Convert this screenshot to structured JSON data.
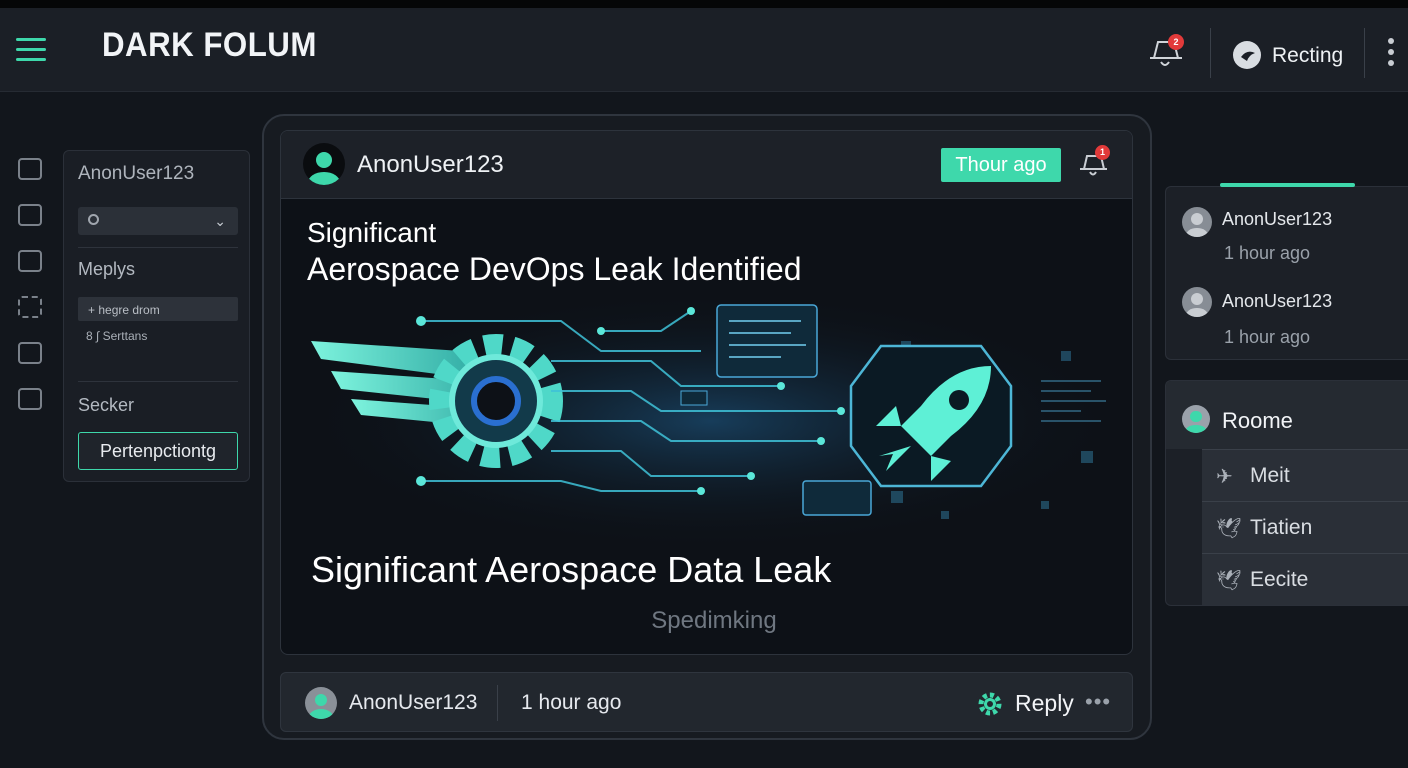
{
  "header": {
    "app_title": "DARK FOLUM",
    "notification_count": "2",
    "user_label": "Recting"
  },
  "left_panel": {
    "username": "AnonUser123",
    "section1_title": "Meplys",
    "item1": "+ hegre drom",
    "item2": "8 ∫ Serttans",
    "section2_title": "Secker",
    "button_label": "Pertenpctiontg"
  },
  "post": {
    "author": "AnonUser123",
    "time_badge": "Thour ago",
    "notification_count": "1",
    "subtitle": "Significant",
    "headline": "Aerospace DevOps Leak Identified",
    "title": "Significant Aerospace Data Leak",
    "footer_text": "Spedimking"
  },
  "bottom_bar": {
    "author": "AnonUser123",
    "time": "1 hour ago",
    "reply_label": "Reply",
    "more_label": "•••"
  },
  "right_panel": {
    "activity": [
      {
        "name": "AnonUser123",
        "time": "1 hour ago"
      },
      {
        "name": "AnonUser123",
        "time": "1 hour ago"
      }
    ],
    "room_title": "Roome",
    "room_items": [
      {
        "icon": "bird-icon",
        "label": "Meit"
      },
      {
        "icon": "bird-icon",
        "label": "Tiatien"
      },
      {
        "icon": "bird-icon",
        "label": "Eecite"
      }
    ]
  },
  "colors": {
    "accent": "#3ed8ab",
    "background": "#12161c",
    "panel": "#1c2027",
    "badge": "#e23a3a"
  }
}
